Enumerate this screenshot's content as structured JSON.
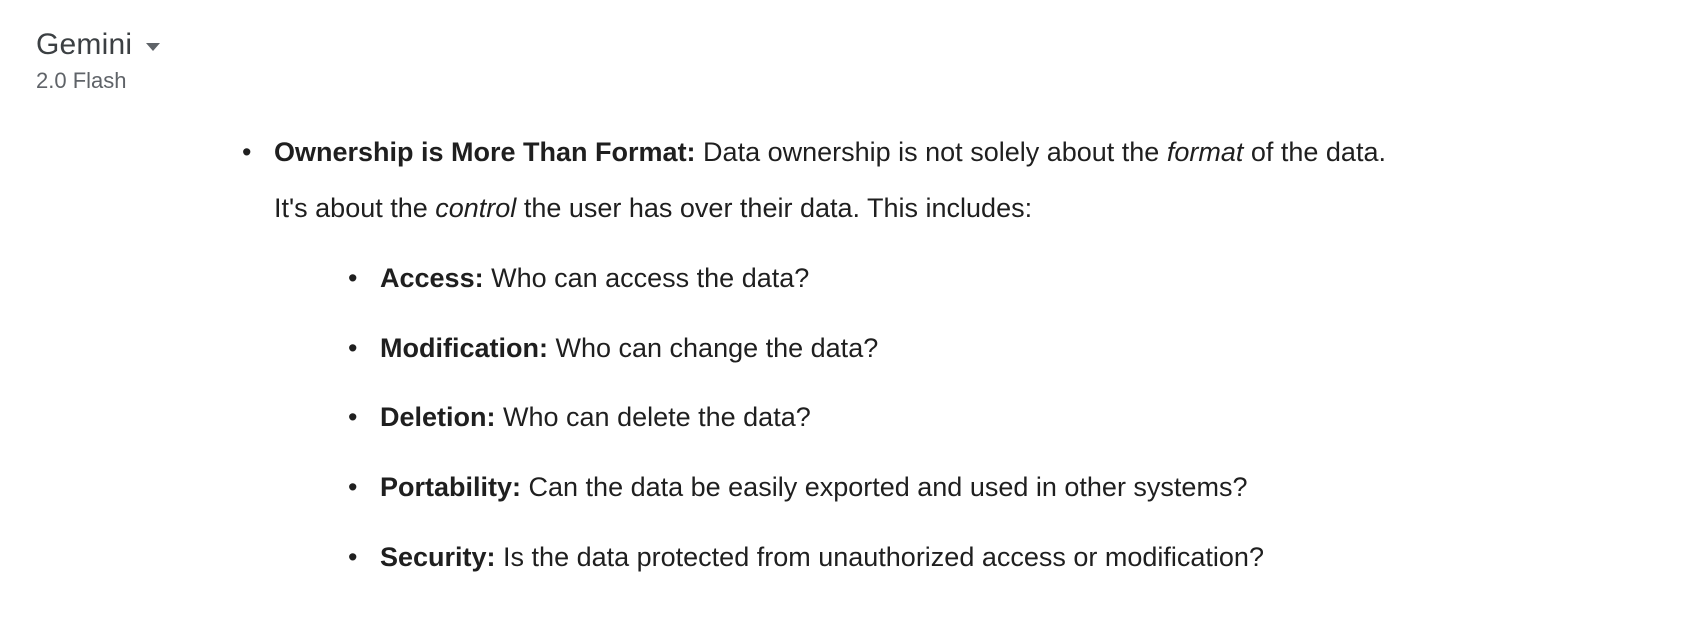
{
  "header": {
    "model_name": "Gemini",
    "model_version": "2.0 Flash"
  },
  "content": {
    "main_item": {
      "title": "Ownership is More Than Format:",
      "text_part1": " Data ownership is not solely about the ",
      "italic1": "format",
      "text_part2": " of the data.",
      "line2_pre": "It's about the ",
      "italic2": "control",
      "line2_post": " the user has over their data. This includes:"
    },
    "sub_items": [
      {
        "label": "Access:",
        "text": " Who can access the data?"
      },
      {
        "label": "Modification:",
        "text": " Who can change the data?"
      },
      {
        "label": "Deletion:",
        "text": " Who can delete the data?"
      },
      {
        "label": "Portability:",
        "text": " Can the data be easily exported and used in other systems?"
      },
      {
        "label": "Security:",
        "text": " Is the data protected from unauthorized access or modification?"
      }
    ]
  }
}
